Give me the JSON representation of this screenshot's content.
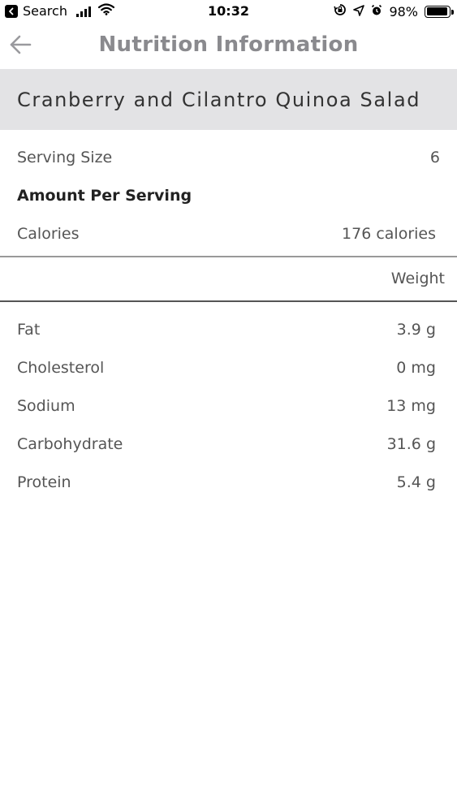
{
  "status_bar": {
    "back_app_label": "Search",
    "time": "10:32",
    "battery_percent": "98%",
    "battery_level": 0.98
  },
  "nav": {
    "title": "Nutrition Information",
    "back_icon": "arrow-left-icon"
  },
  "recipe": {
    "title": "Cranberry and Cilantro Quinoa Salad"
  },
  "serving": {
    "label": "Serving Size",
    "value": "6"
  },
  "amount_per_serving_label": "Amount Per Serving",
  "calories": {
    "label": "Calories",
    "value": "176 calories"
  },
  "table": {
    "weight_header": "Weight",
    "rows": [
      {
        "label": "Fat",
        "value": "3.9 g"
      },
      {
        "label": "Cholesterol",
        "value": "0 mg"
      },
      {
        "label": "Sodium",
        "value": "13 mg"
      },
      {
        "label": "Carbohydrate",
        "value": "31.6 g"
      },
      {
        "label": "Protein",
        "value": "5.4 g"
      }
    ]
  },
  "colors": {
    "title_band": "#e3e3e5",
    "nav_title": "#8a8a8e",
    "text": "#555555"
  }
}
